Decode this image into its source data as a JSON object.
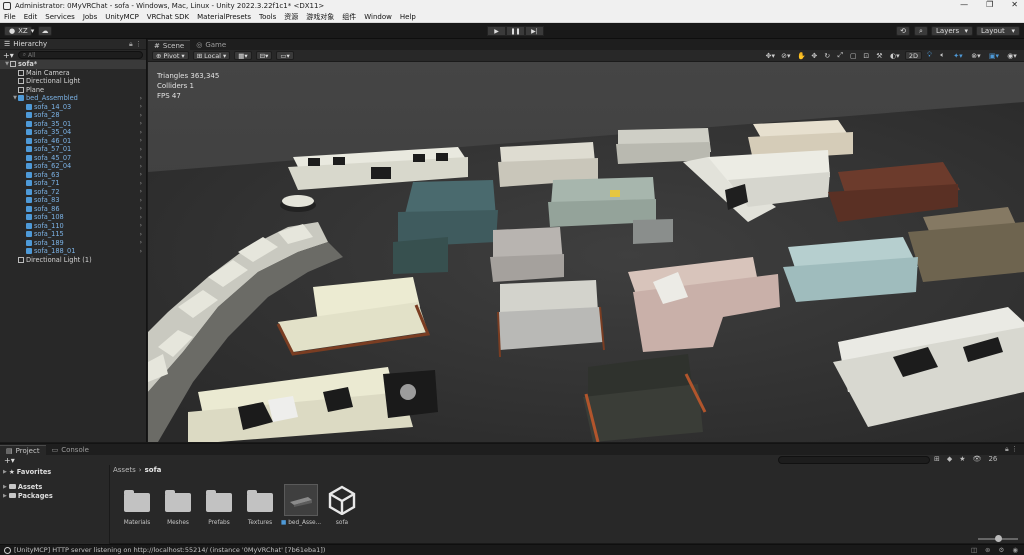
{
  "window": {
    "title": "Administrator: 0MyVRChat - sofa - Windows, Mac, Linux - Unity 2022.3.22f1c1* <DX11>",
    "minimize": "—",
    "restore": "❐",
    "close": "✕"
  },
  "menu": [
    "File",
    "Edit",
    "Services",
    "Jobs",
    "UnityMCP",
    "VRChat SDK",
    "MaterialPresets",
    "Tools",
    "资源",
    "游戏对象",
    "组件",
    "Window",
    "Help"
  ],
  "toolbar": {
    "account": "XZ",
    "layers": "Layers",
    "layout": "Layout"
  },
  "hierarchy": {
    "tab": "Hierarchy",
    "search_placeholder": "All",
    "items": [
      {
        "label": "sofa*",
        "depth": 0,
        "arrow": "▼",
        "type": "scene"
      },
      {
        "label": "Main Camera",
        "depth": 1,
        "arrow": "",
        "type": "go"
      },
      {
        "label": "Directional Light",
        "depth": 1,
        "arrow": "",
        "type": "go"
      },
      {
        "label": "Plane",
        "depth": 1,
        "arrow": "",
        "type": "go"
      },
      {
        "label": "bed_Assembled",
        "depth": 1,
        "arrow": "▼",
        "type": "prefab"
      },
      {
        "label": "sofa_14_03",
        "depth": 2,
        "arrow": "",
        "type": "prefab"
      },
      {
        "label": "sofa_28",
        "depth": 2,
        "arrow": "",
        "type": "prefab"
      },
      {
        "label": "sofa_35_01",
        "depth": 2,
        "arrow": "",
        "type": "prefab"
      },
      {
        "label": "sofa_35_04",
        "depth": 2,
        "arrow": "",
        "type": "prefab"
      },
      {
        "label": "sofa_46_01",
        "depth": 2,
        "arrow": "",
        "type": "prefab"
      },
      {
        "label": "sofa_57_01",
        "depth": 2,
        "arrow": "",
        "type": "prefab"
      },
      {
        "label": "sofa_45_07",
        "depth": 2,
        "arrow": "",
        "type": "prefab"
      },
      {
        "label": "sofa_62_04",
        "depth": 2,
        "arrow": "",
        "type": "prefab"
      },
      {
        "label": "sofa_63",
        "depth": 2,
        "arrow": "",
        "type": "prefab"
      },
      {
        "label": "sofa_71",
        "depth": 2,
        "arrow": "",
        "type": "prefab"
      },
      {
        "label": "sofa_72",
        "depth": 2,
        "arrow": "",
        "type": "prefab"
      },
      {
        "label": "sofa_83",
        "depth": 2,
        "arrow": "",
        "type": "prefab"
      },
      {
        "label": "sofa_86",
        "depth": 2,
        "arrow": "",
        "type": "prefab"
      },
      {
        "label": "sofa_108",
        "depth": 2,
        "arrow": "",
        "type": "prefab"
      },
      {
        "label": "sofa_110",
        "depth": 2,
        "arrow": "",
        "type": "prefab"
      },
      {
        "label": "sofa_115",
        "depth": 2,
        "arrow": "",
        "type": "prefab"
      },
      {
        "label": "sofa_189",
        "depth": 2,
        "arrow": "",
        "type": "prefab"
      },
      {
        "label": "sofa_188_01",
        "depth": 2,
        "arrow": "",
        "type": "prefab"
      },
      {
        "label": "Directional Light (1)",
        "depth": 1,
        "arrow": "",
        "type": "go"
      }
    ]
  },
  "scene": {
    "tabs": [
      "Scene",
      "Game"
    ],
    "pivot": "Pivot",
    "space": "Local",
    "mode_2d": "2D",
    "stats": {
      "triangles": "Triangles 363,345",
      "colliders": "Colliders 1",
      "fps": "FPS 47"
    }
  },
  "project": {
    "tabs": [
      "Project",
      "Console"
    ],
    "favorites": "Favorites",
    "folders": [
      "Assets",
      "Packages"
    ],
    "breadcrumb": [
      "Assets",
      "sofa"
    ],
    "count": "26",
    "assets": [
      {
        "label": "Materials",
        "kind": "folder"
      },
      {
        "label": "Meshes",
        "kind": "folder"
      },
      {
        "label": "Prefabs",
        "kind": "folder"
      },
      {
        "label": "Textures",
        "kind": "folder"
      },
      {
        "label": "bed_Asse...",
        "kind": "prefab"
      },
      {
        "label": "sofa",
        "kind": "unity-scene"
      }
    ]
  },
  "status": {
    "message": "[UnityMCP] HTTP server listening on http://localhost:55214/  (instance '0MyVRChat' [7b61eba1])"
  },
  "colors": {
    "accent_blue": "#4e9ad8",
    "panel_bg": "#282828",
    "toolbar_bg": "#191919"
  }
}
